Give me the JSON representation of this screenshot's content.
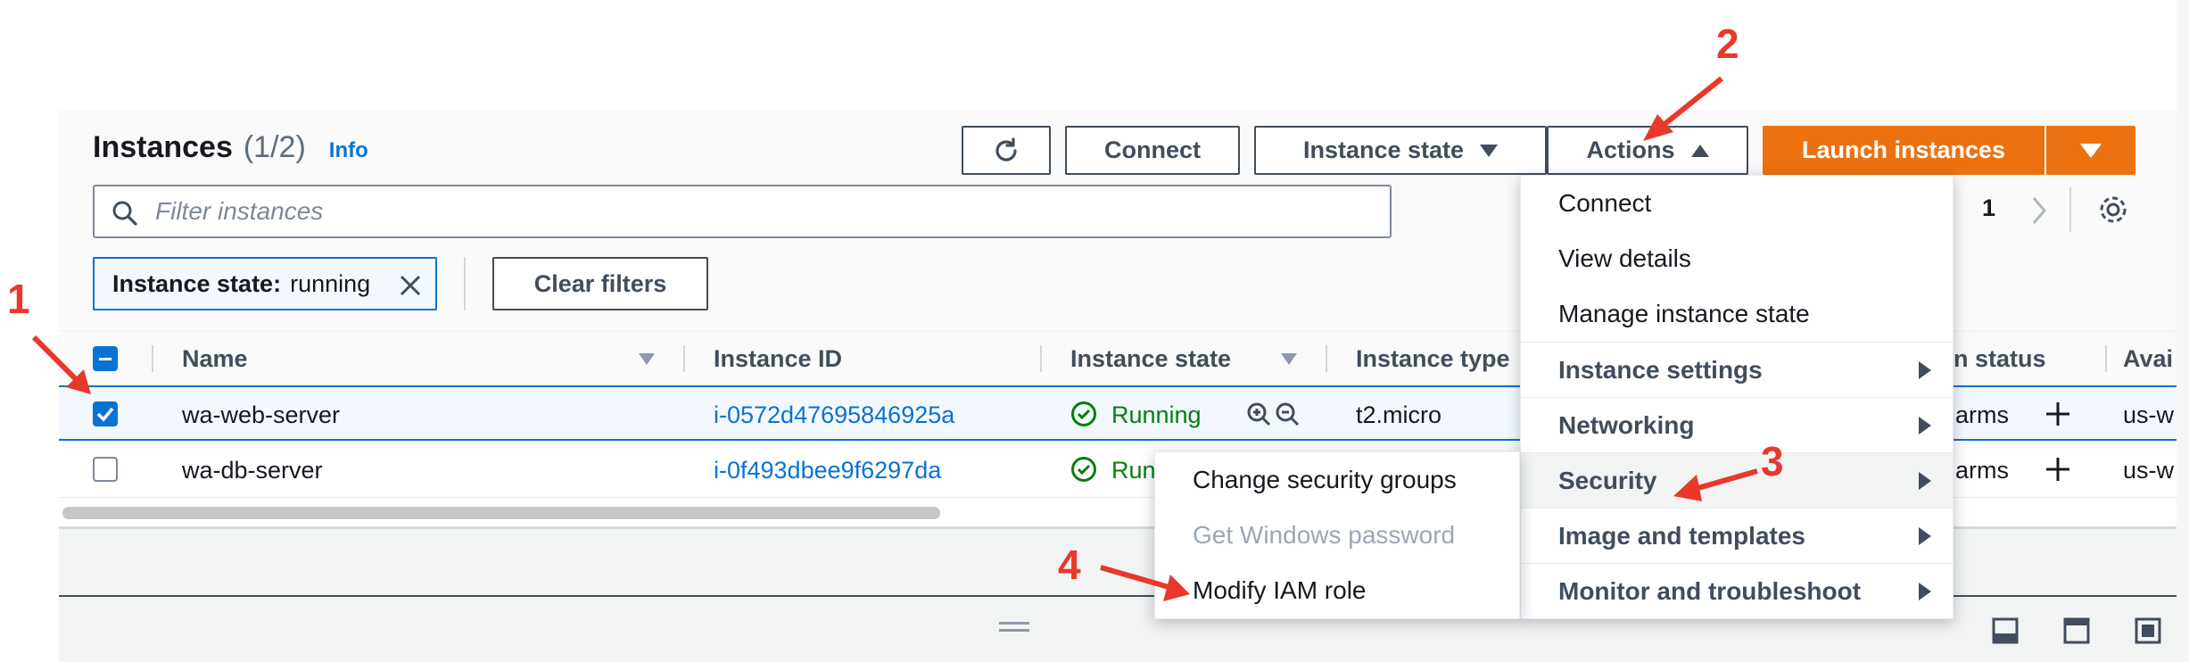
{
  "header": {
    "title": "Instances",
    "count": "(1/2)",
    "info": "Info"
  },
  "toolbar": {
    "connect": "Connect",
    "instance_state": "Instance state",
    "actions": "Actions",
    "launch": "Launch instances"
  },
  "search": {
    "placeholder": "Filter instances"
  },
  "filter_token": {
    "key": "Instance state:",
    "value": "running"
  },
  "clear_filters": "Clear filters",
  "pagination": {
    "page": "1"
  },
  "table": {
    "columns": {
      "name": "Name",
      "instance_id": "Instance ID",
      "instance_state": "Instance state",
      "instance_type": "Instance type",
      "status_check": "n status",
      "availability": "Avai"
    },
    "rows": [
      {
        "name": "wa-web-server",
        "id": "i-0572d47695846925a",
        "state": "Running",
        "type": "t2.micro",
        "alarms": "arms",
        "az": "us-w",
        "selected": true
      },
      {
        "name": "wa-db-server",
        "id": "i-0f493dbee9f6297da",
        "state": "Runi",
        "type": "",
        "alarms": "arms",
        "az": "us-w",
        "selected": false
      }
    ]
  },
  "actions_menu": {
    "items": [
      {
        "label": "Connect"
      },
      {
        "label": "View details"
      },
      {
        "label": "Manage instance state"
      },
      {
        "label": "Instance settings"
      },
      {
        "label": "Networking"
      },
      {
        "label": "Security"
      },
      {
        "label": "Image and templates"
      },
      {
        "label": "Monitor and troubleshoot"
      }
    ]
  },
  "security_submenu": {
    "items": [
      {
        "label": "Change security groups"
      },
      {
        "label": "Get Windows password"
      },
      {
        "label": "Modify IAM role"
      }
    ]
  },
  "annotations": {
    "a1": "1",
    "a2": "2",
    "a3": "3",
    "a4": "4"
  },
  "colors": {
    "accent": "#0972d3",
    "launch": "#ec7211",
    "annotation": "#e8382b",
    "running": "#037f0c"
  }
}
